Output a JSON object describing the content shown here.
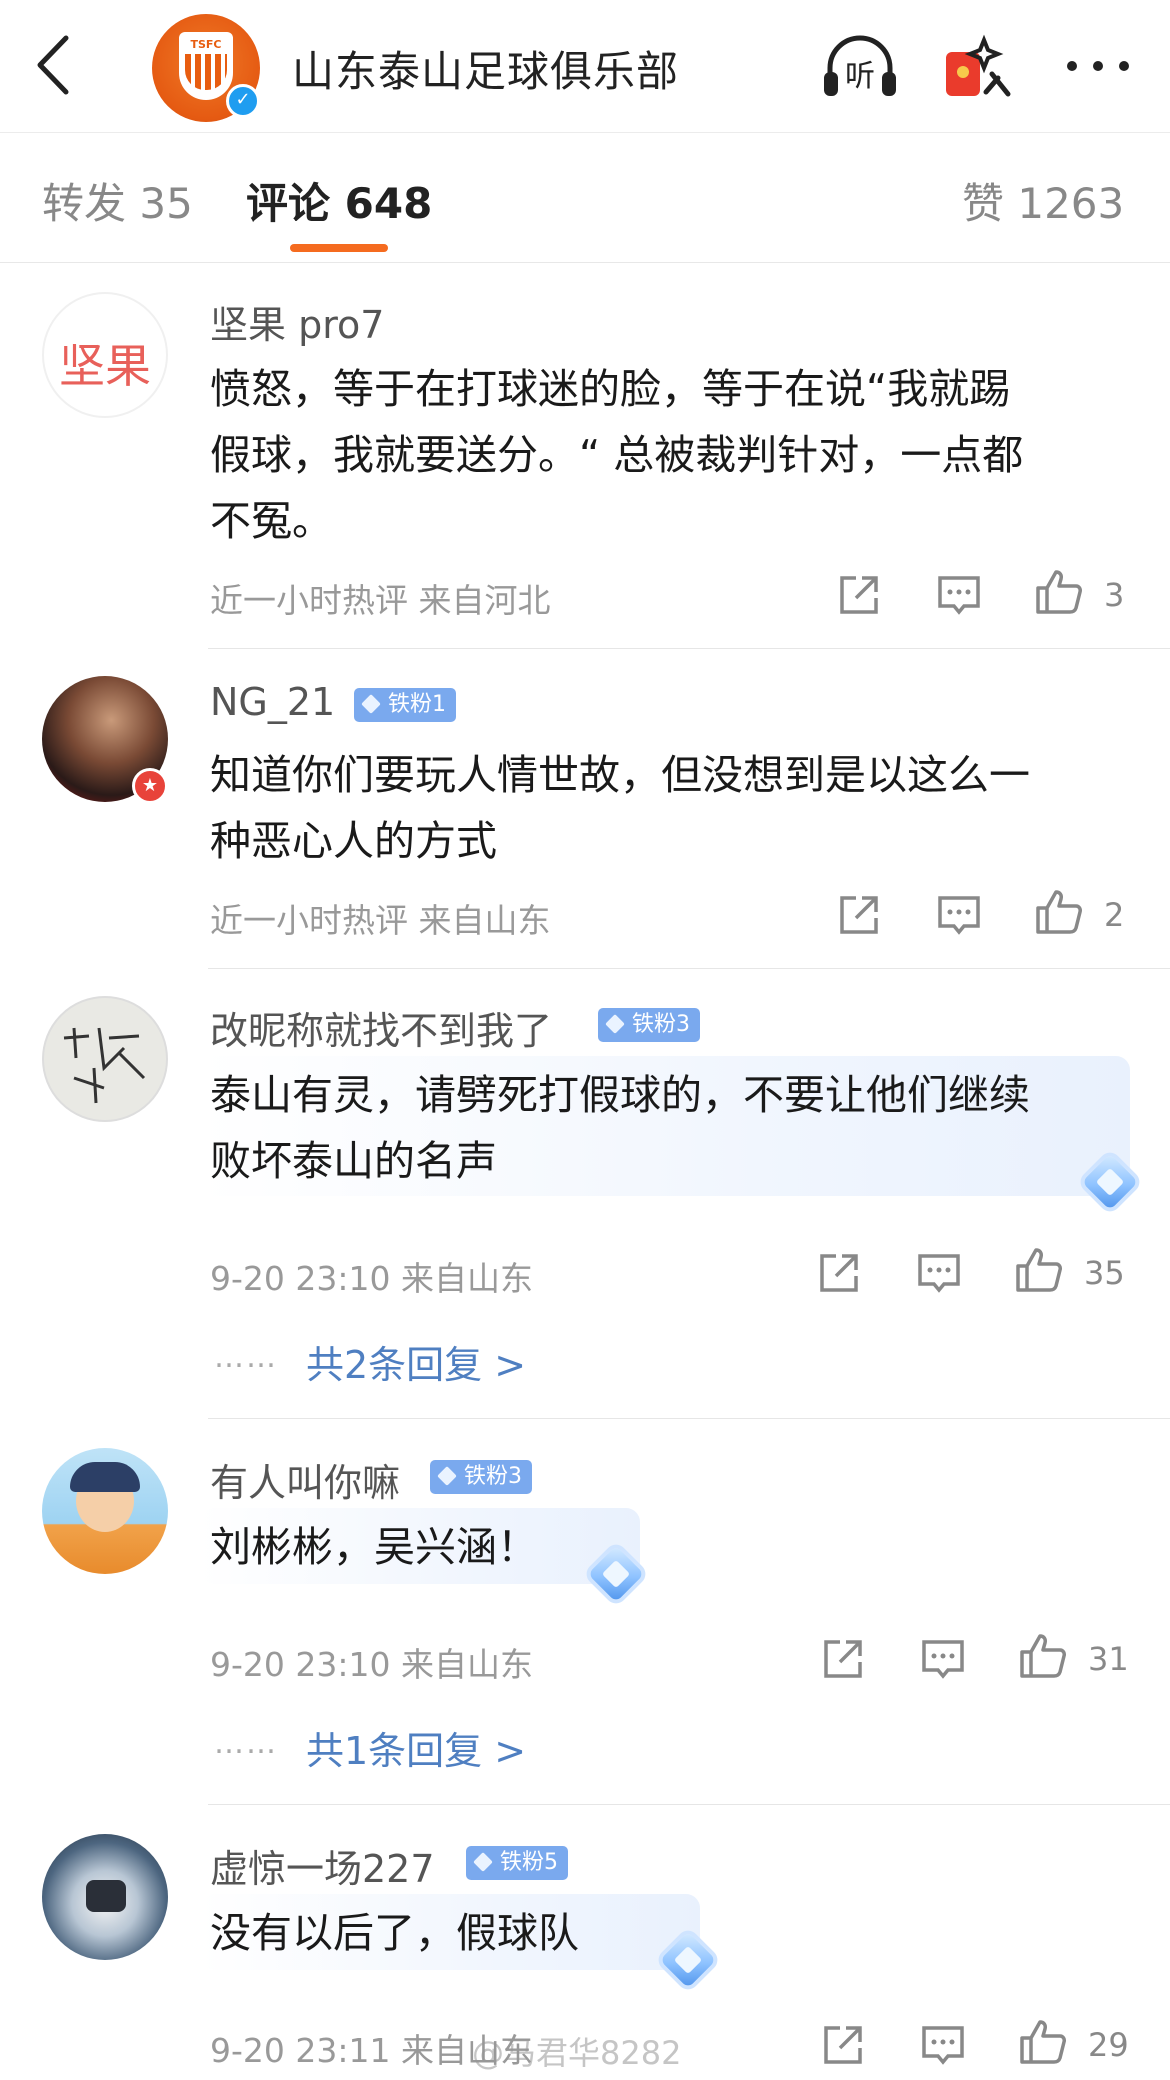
{
  "header": {
    "title": "山东泰山足球俱乐部",
    "logo_text": "TSFC",
    "icons": [
      "back-chevron-icon",
      "listen-headphones-icon",
      "red-envelope-icon",
      "more-icon"
    ],
    "listen_label": "听"
  },
  "tabs": {
    "repost": "转发 35",
    "comments": "评论 648",
    "likes": "赞 1263",
    "accent": "#f56b1f"
  },
  "comments": [
    {
      "username": "坚果 pro7",
      "avatar_text": "坚果",
      "text_lines": [
        "愤怒，等于在打球迷的脸，等于在说“我就踢",
        "假球，我就要送分。“ 总被裁判针对，一点都",
        "不冤。"
      ],
      "meta": "近一小时热评  来自河北",
      "likes": "3"
    },
    {
      "username": "NG_21",
      "badge": "铁粉1",
      "text_lines": [
        "知道你们要玩人情世故，但没想到是以这么一",
        "种恶心人的方式"
      ],
      "meta": "近一小时热评  来自山东",
      "likes": "2"
    },
    {
      "username": "改昵称就找不到我了",
      "badge": "铁粉3",
      "text_lines": [
        "泰山有灵，请劈死打假球的，不要让他们继续",
        "败坏泰山的名声"
      ],
      "meta": "9-20 23:10  来自山东",
      "likes": "35",
      "replies": "共2条回复 >"
    },
    {
      "username": "有人叫你嘛",
      "badge": "铁粉3",
      "text_lines": [
        "刘彬彬，吴兴涵！"
      ],
      "meta": "9-20 23:10  来自山东",
      "likes": "31",
      "replies": "共1条回复 >"
    },
    {
      "username": "虚惊一场227",
      "badge": "铁粉5",
      "text_lines": [
        "没有以后了，假球队"
      ],
      "meta": "9-20 23:11  来自山东",
      "likes": "29"
    }
  ],
  "reply_dots": "……",
  "watermark": "@马君华8282",
  "colors": {
    "badge": "#7aa9ee",
    "reply_link": "#4f7fc1",
    "verified": "#1f9df0"
  }
}
